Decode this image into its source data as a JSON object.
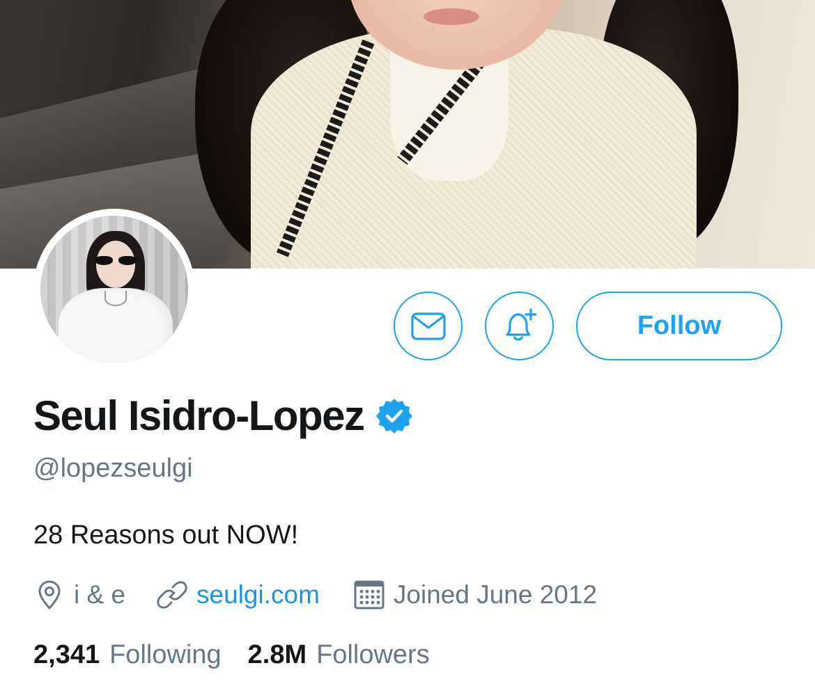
{
  "profile": {
    "display_name": "Seul Isidro-Lopez",
    "handle": "@lopezseulgi",
    "verified": true,
    "bio": "28 Reasons out NOW!",
    "location": "i & e",
    "website": "seulgi.com",
    "joined": "Joined June 2012"
  },
  "actions": {
    "message_icon": "envelope-icon",
    "notify_icon": "bell-plus-icon",
    "follow_label": "Follow"
  },
  "stats": {
    "following_count": "2,341",
    "following_label": "Following",
    "followers_count": "2.8M",
    "followers_label": "Followers"
  },
  "colors": {
    "accent": "#1da1f2",
    "link": "#1b95e0",
    "muted": "#657786",
    "text": "#14171a"
  }
}
